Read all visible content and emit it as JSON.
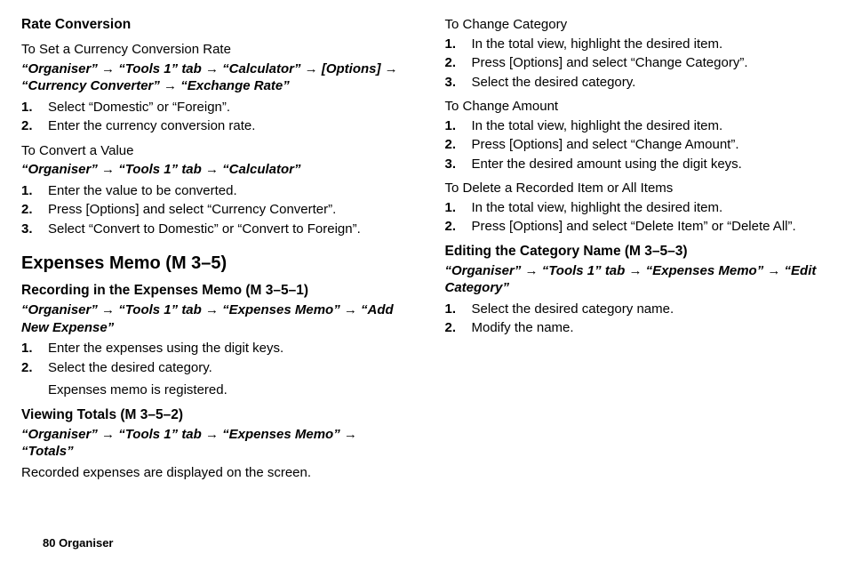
{
  "left": {
    "rateConversion": {
      "title": "Rate Conversion",
      "setRate": {
        "heading": "To Set a Currency Conversion Rate",
        "path": "“Organiser” → “Tools 1” tab → “Calculator” → [Options] → “Currency Converter” → “Exchange Rate”",
        "steps": [
          "Select “Domestic” or “Foreign”.",
          "Enter the currency conversion rate."
        ]
      },
      "convertValue": {
        "heading": "To Convert a Value",
        "path": "“Organiser” → “Tools 1” tab → “Calculator”",
        "steps": [
          "Enter the value to be converted.",
          "Press [Options] and select “Currency Converter”.",
          "Select “Convert to Domestic” or “Convert to Foreign”."
        ]
      }
    },
    "expensesMemo": {
      "heading": "Expenses Memo (M 3–5)",
      "recording": {
        "title": "Recording in the Expenses Memo (M 3–5–1)",
        "path": "“Organiser” → “Tools 1” tab → “Expenses Memo” → “Add New Expense”",
        "steps": [
          "Enter the expenses using the digit keys.",
          "Select the desired category."
        ],
        "note": "Expenses memo is registered."
      },
      "viewing": {
        "title": "Viewing Totals (M 3–5–2)",
        "path": "“Organiser” → “Tools 1” tab → “Expenses Memo” → “Totals”",
        "body": "Recorded expenses are displayed on the screen."
      }
    }
  },
  "right": {
    "changeCategory": {
      "heading": "To Change Category",
      "steps": [
        "In the total view, highlight the desired item.",
        "Press [Options] and select “Change Category”.",
        "Select the desired category."
      ]
    },
    "changeAmount": {
      "heading": "To Change Amount",
      "steps": [
        "In the total view, highlight the desired item.",
        "Press [Options] and select “Change Amount”.",
        "Enter the desired amount using the digit keys."
      ]
    },
    "deleteItem": {
      "heading": "To Delete a Recorded Item or All Items",
      "steps": [
        "In the total view, highlight the desired item.",
        "Press [Options] and select “Delete Item” or “Delete All”."
      ]
    },
    "editCategory": {
      "title": "Editing the Category Name (M 3–5–3)",
      "path": "“Organiser” → “Tools 1” tab → “Expenses Memo” → “Edit Category”",
      "steps": [
        "Select the desired category name.",
        "Modify the name."
      ]
    }
  },
  "footer": "80    Organiser"
}
